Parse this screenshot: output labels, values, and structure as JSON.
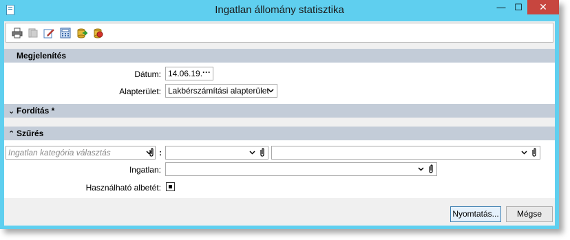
{
  "window": {
    "title": "Ingatlan állomány statisztika",
    "minimize_glyph": "—",
    "maximize_glyph": "☐",
    "close_glyph": "✕"
  },
  "toolbar": {
    "icons": [
      "print-icon",
      "print-preview-icon",
      "edit-icon",
      "calculator-icon",
      "export-icon",
      "database-icon"
    ]
  },
  "sections": {
    "display": {
      "title": "Megjelenítés",
      "caret": "",
      "expanded": true
    },
    "translation": {
      "title": "Fordítás *",
      "caret": "⌄",
      "expanded": false
    },
    "filter": {
      "title": "Szűrés",
      "caret": "⌃",
      "expanded": true
    }
  },
  "display_form": {
    "date_label": "Dátum:",
    "date_value": "14.06.19.",
    "date_button": "···",
    "area_label": "Alapterület:",
    "area_value": "Lakbérszámítási alapterület"
  },
  "filter_form": {
    "category_placeholder": "Ingatlan kategória választás",
    "colon": ":",
    "category_second_value": "",
    "category_third_value": "",
    "property_label": "Ingatlan:",
    "property_value": "",
    "usable_label": "Használható albetét:",
    "usable_checked": true
  },
  "buttons": {
    "print": "Nyomtatás...",
    "cancel": "Mégse"
  },
  "colors": {
    "titlebar": "#5fcfef",
    "section_header": "#c3ccd8",
    "close_button": "#c7463f"
  }
}
